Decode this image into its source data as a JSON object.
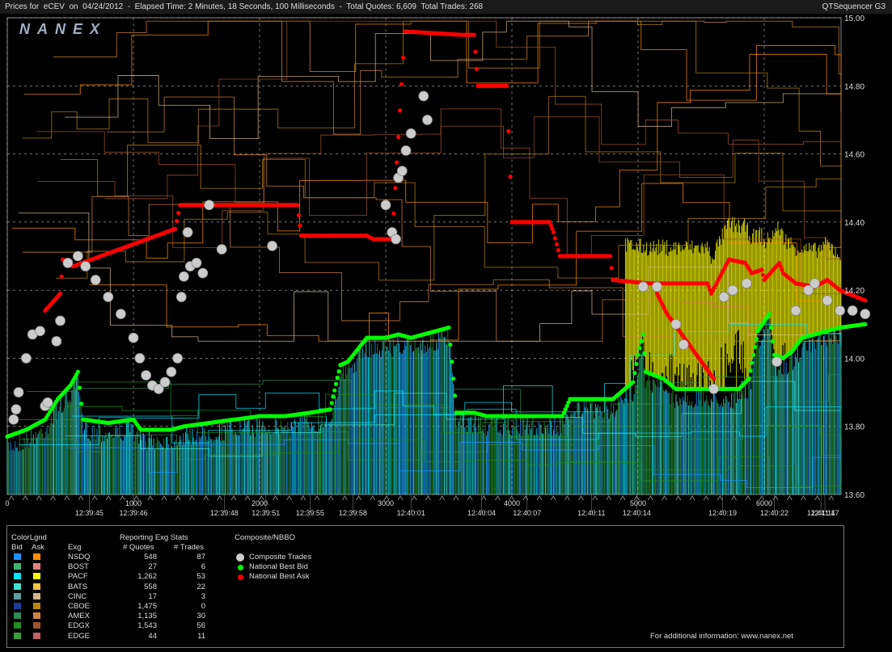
{
  "window": {
    "title": "Prices for  eCEV  on  04/24/2012  -  Elapsed Time: 2 Minutes, 18 Seconds, 100 Milliseconds  -  Total Quotes: 6,609  Total Trades: 268",
    "app_name": "QTSequencer G3",
    "watermark": "NANEX"
  },
  "chart_data": {
    "type": "line",
    "title": "Prices for eCEV on 04/24/2012",
    "ylim": [
      13.6,
      15.0
    ],
    "xlim": [
      0,
      6609
    ],
    "y_ticks": [
      "15.00",
      "14.80",
      "14.60",
      "14.40",
      "14.20",
      "14.00",
      "13.80",
      "13.60"
    ],
    "x_ticks": [
      "0",
      "1000",
      "2000",
      "3000",
      "4000",
      "5000",
      "6000"
    ],
    "time_labels": [
      {
        "x": 650,
        "label": "12:39:45"
      },
      {
        "x": 1000,
        "label": "12:39:46"
      },
      {
        "x": 1720,
        "label": "12:39:48"
      },
      {
        "x": 2050,
        "label": "12:39:51"
      },
      {
        "x": 2400,
        "label": "12:39:55"
      },
      {
        "x": 2740,
        "label": "12:39:58"
      },
      {
        "x": 3200,
        "label": "12:40:01"
      },
      {
        "x": 3760,
        "label": "12:40:04"
      },
      {
        "x": 4120,
        "label": "12:40:07"
      },
      {
        "x": 4630,
        "label": "12:40:11"
      },
      {
        "x": 4990,
        "label": "12:40:14"
      },
      {
        "x": 5670,
        "label": "12:40:19"
      },
      {
        "x": 6080,
        "label": "12:40:22"
      },
      {
        "x": 6450,
        "label": "12:41:11"
      },
      {
        "x": 6780,
        "label": "12:41:47"
      }
    ],
    "series": [
      {
        "name": "National Best Bid",
        "color": "#00ff00",
        "points": [
          [
            0,
            13.77
          ],
          [
            150,
            13.79
          ],
          [
            300,
            13.82
          ],
          [
            400,
            13.88
          ],
          [
            500,
            13.92
          ],
          [
            560,
            13.96
          ],
          [
            600,
            13.82
          ],
          [
            800,
            13.81
          ],
          [
            1000,
            13.82
          ],
          [
            1060,
            13.79
          ],
          [
            1300,
            13.79
          ],
          [
            1400,
            13.8
          ],
          [
            1600,
            13.81
          ],
          [
            1800,
            13.82
          ],
          [
            2000,
            13.83
          ],
          [
            2200,
            13.83
          ],
          [
            2400,
            13.84
          ],
          [
            2560,
            13.85
          ],
          [
            2640,
            13.98
          ],
          [
            2700,
            13.99
          ],
          [
            2850,
            14.06
          ],
          [
            3000,
            14.06
          ],
          [
            3100,
            14.07
          ],
          [
            3200,
            14.06
          ],
          [
            3300,
            14.07
          ],
          [
            3400,
            14.08
          ],
          [
            3500,
            14.09
          ],
          [
            3560,
            13.84
          ],
          [
            3700,
            13.84
          ],
          [
            3800,
            13.83
          ],
          [
            4000,
            13.83
          ],
          [
            4400,
            13.83
          ],
          [
            4460,
            13.88
          ],
          [
            4700,
            13.88
          ],
          [
            4800,
            13.88
          ],
          [
            4960,
            13.93
          ],
          [
            5000,
            14.01
          ],
          [
            5040,
            14.07
          ],
          [
            5060,
            13.96
          ],
          [
            5200,
            13.94
          ],
          [
            5300,
            13.91
          ],
          [
            5600,
            13.91
          ],
          [
            5800,
            13.91
          ],
          [
            5880,
            13.94
          ],
          [
            5950,
            14.08
          ],
          [
            6040,
            14.13
          ],
          [
            6080,
            14.01
          ],
          [
            6150,
            14.0
          ],
          [
            6220,
            14.02
          ],
          [
            6300,
            14.06
          ],
          [
            6400,
            14.07
          ],
          [
            6500,
            14.08
          ],
          [
            6600,
            14.09
          ],
          [
            6800,
            14.1
          ]
        ]
      },
      {
        "name": "National Best Ask",
        "color": "#ff0000",
        "points": [
          [
            300,
            14.14
          ],
          [
            420,
            14.19
          ],
          [
            440,
            14.29
          ],
          [
            520,
            14.27
          ],
          [
            1330,
            14.38
          ],
          [
            1370,
            14.45
          ],
          [
            1500,
            14.45
          ],
          [
            1600,
            14.45
          ],
          [
            2300,
            14.45
          ],
          [
            2330,
            14.36
          ],
          [
            2850,
            14.36
          ],
          [
            2900,
            14.35
          ],
          [
            3050,
            14.35
          ],
          [
            3100,
            14.65
          ],
          [
            3150,
            14.96
          ],
          [
            3600,
            14.95
          ],
          [
            3700,
            14.95
          ],
          [
            3730,
            14.8
          ],
          [
            3960,
            14.8
          ],
          [
            4000,
            14.4
          ],
          [
            4300,
            14.4
          ],
          [
            4330,
            14.37
          ],
          [
            4380,
            14.3
          ],
          [
            4780,
            14.3
          ],
          [
            4800,
            14.23
          ],
          [
            5080,
            14.22
          ],
          [
            5550,
            14.22
          ],
          [
            5580,
            14.19
          ],
          [
            5720,
            14.29
          ],
          [
            5850,
            14.28
          ],
          [
            5900,
            14.25
          ],
          [
            5980,
            14.26
          ],
          [
            6000,
            14.23
          ],
          [
            6120,
            14.28
          ],
          [
            6150,
            14.25
          ],
          [
            6250,
            14.22
          ],
          [
            6400,
            14.21
          ],
          [
            6500,
            14.23
          ],
          [
            6600,
            14.2
          ],
          [
            6800,
            14.17
          ]
        ],
        "drop_segment": [
          [
            5150,
            14.19
          ],
          [
            5230,
            14.13
          ],
          [
            5600,
            13.94
          ]
        ]
      },
      {
        "name": "Composite Trades",
        "color": "#cccccc",
        "points": [
          [
            50,
            13.82
          ],
          [
            70,
            13.85
          ],
          [
            90,
            13.9
          ],
          [
            150,
            14.0
          ],
          [
            200,
            14.07
          ],
          [
            260,
            14.08
          ],
          [
            300,
            13.86
          ],
          [
            320,
            13.87
          ],
          [
            390,
            14.05
          ],
          [
            420,
            14.11
          ],
          [
            480,
            14.28
          ],
          [
            560,
            14.3
          ],
          [
            620,
            14.27
          ],
          [
            700,
            14.23
          ],
          [
            800,
            14.18
          ],
          [
            900,
            14.13
          ],
          [
            1000,
            14.06
          ],
          [
            1050,
            14.0
          ],
          [
            1100,
            13.95
          ],
          [
            1150,
            13.92
          ],
          [
            1200,
            13.91
          ],
          [
            1250,
            13.93
          ],
          [
            1300,
            13.96
          ],
          [
            1350,
            14.0
          ],
          [
            1380,
            14.18
          ],
          [
            1400,
            14.24
          ],
          [
            1430,
            14.37
          ],
          [
            1450,
            14.27
          ],
          [
            1500,
            14.28
          ],
          [
            1550,
            14.25
          ],
          [
            1600,
            14.45
          ],
          [
            1700,
            14.32
          ],
          [
            2100,
            14.33
          ],
          [
            3000,
            14.45
          ],
          [
            3050,
            14.37
          ],
          [
            3080,
            14.35
          ],
          [
            3100,
            14.53
          ],
          [
            3130,
            14.55
          ],
          [
            3160,
            14.61
          ],
          [
            3200,
            14.66
          ],
          [
            3300,
            14.77
          ],
          [
            3330,
            14.7
          ],
          [
            5040,
            14.21
          ],
          [
            5150,
            14.21
          ],
          [
            5300,
            14.1
          ],
          [
            5360,
            14.04
          ],
          [
            5600,
            13.91
          ],
          [
            5680,
            14.18
          ],
          [
            5750,
            14.2
          ],
          [
            5860,
            14.22
          ],
          [
            6100,
            13.99
          ],
          [
            6250,
            14.14
          ],
          [
            6350,
            14.2
          ],
          [
            6400,
            14.22
          ],
          [
            6500,
            14.17
          ],
          [
            6600,
            14.14
          ],
          [
            6700,
            14.14
          ],
          [
            6800,
            14.13
          ]
        ]
      }
    ]
  },
  "legend": {
    "colorlegend_title": "ColorLgnd",
    "bid_label": "Bid",
    "ask_label": "Ask",
    "exchange_stats_title": "Reporting Exg Stats",
    "col_exchange": "Exg",
    "col_quotes": "# Quotes",
    "col_trades": "# Trades",
    "exchanges": [
      {
        "name": "NSDQ",
        "quotes": "548",
        "trades": "87",
        "bid_color": "#1e90ff",
        "ask_color": "#ff8c00"
      },
      {
        "name": "BOST",
        "quotes": "27",
        "trades": "6",
        "bid_color": "#3cb371",
        "ask_color": "#e08080"
      },
      {
        "name": "PACF",
        "quotes": "1,262",
        "trades": "53",
        "bid_color": "#00e5ff",
        "ask_color": "#ffff00"
      },
      {
        "name": "BATS",
        "quotes": "558",
        "trades": "22",
        "bid_color": "#40e0d0",
        "ask_color": "#f5c542"
      },
      {
        "name": "CINC",
        "quotes": "17",
        "trades": "3",
        "bid_color": "#5f9ea0",
        "ask_color": "#d2b48c"
      },
      {
        "name": "CBOE",
        "quotes": "1,475",
        "trades": "0",
        "bid_color": "#1e3c96",
        "ask_color": "#b8860b"
      },
      {
        "name": "AMEX",
        "quotes": "1,135",
        "trades": "30",
        "bid_color": "#2e8b57",
        "ask_color": "#cd853f"
      },
      {
        "name": "EDGX",
        "quotes": "1,543",
        "trades": "56",
        "bid_color": "#228b22",
        "ask_color": "#a0522d"
      },
      {
        "name": "EDGE",
        "quotes": "44",
        "trades": "11",
        "bid_color": "#3a9d3a",
        "ask_color": "#c06060"
      }
    ],
    "composite_title": "Composite/NBBO",
    "composite_items": [
      {
        "label": "Composite Trades",
        "color": "#cccccc"
      },
      {
        "label": "National Best Bid",
        "color": "#00ff00"
      },
      {
        "label": "National Best Ask",
        "color": "#ff0000"
      }
    ],
    "footer": "For additional information: www.nanex.net"
  },
  "colors": {
    "background": "#000000",
    "grid": "#aaaaaa",
    "axis_text": "#dddddd"
  }
}
